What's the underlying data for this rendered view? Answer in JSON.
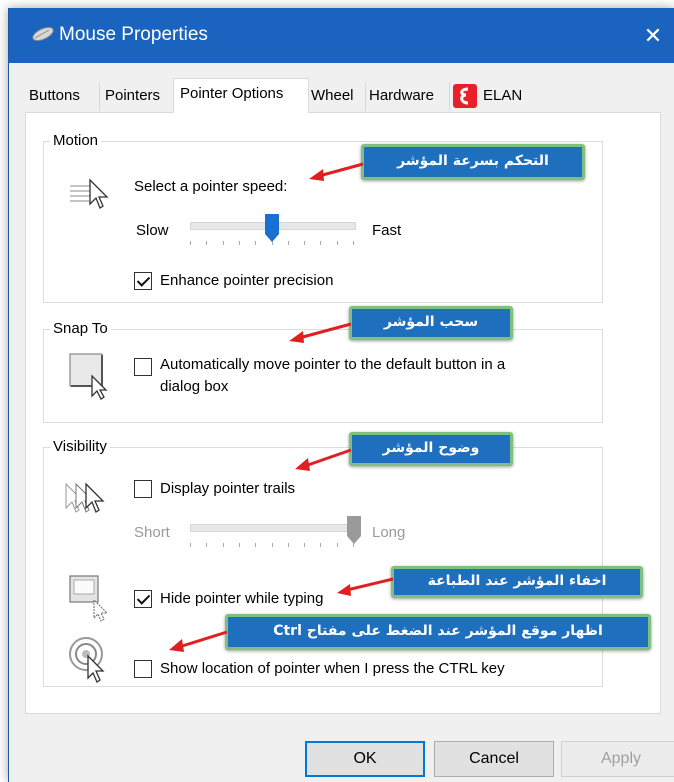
{
  "window": {
    "title": "Mouse Properties",
    "close_glyph": "✕",
    "accent": "#1a64c0"
  },
  "tabs": [
    {
      "label": "Buttons"
    },
    {
      "label": "Pointers"
    },
    {
      "label": "Pointer Options",
      "active": true
    },
    {
      "label": "Wheel"
    },
    {
      "label": "Hardware"
    },
    {
      "label": "ELAN",
      "icon": "elan-logo-icon"
    }
  ],
  "motion": {
    "title": "Motion",
    "speed_label": "Select a pointer speed:",
    "slow": "Slow",
    "fast": "Fast",
    "speed_level": 0.5,
    "enhance_label": "Enhance pointer precision",
    "enhance_checked": true
  },
  "snap": {
    "title": "Snap To",
    "line1": "Automatically move pointer to the default button in a",
    "line2": "dialog box",
    "checked": false
  },
  "visibility": {
    "title": "Visibility",
    "trails_label": "Display pointer trails",
    "trails_checked": false,
    "short": "Short",
    "long": "Long",
    "trail_level": 1.0,
    "hide_label": "Hide pointer while typing",
    "hide_checked": true,
    "ctrl_label": "Show location of pointer when I press the CTRL key",
    "ctrl_checked": false
  },
  "callouts": {
    "speed": "التحكم بسرعة المؤشر",
    "snap": "سحب المؤشر",
    "visibility": "وضوح المؤشر",
    "hide": "اخفاء المؤشر عند الطباعة",
    "ctrl": "اظهار موقع المؤشر عند الضغط على مفتاح Ctrl",
    "color": "#1f6fbf",
    "border_color": "#7fc07f",
    "arrow_color": "#e02020"
  },
  "buttons": {
    "ok": "OK",
    "cancel": "Cancel",
    "apply": "Apply"
  }
}
